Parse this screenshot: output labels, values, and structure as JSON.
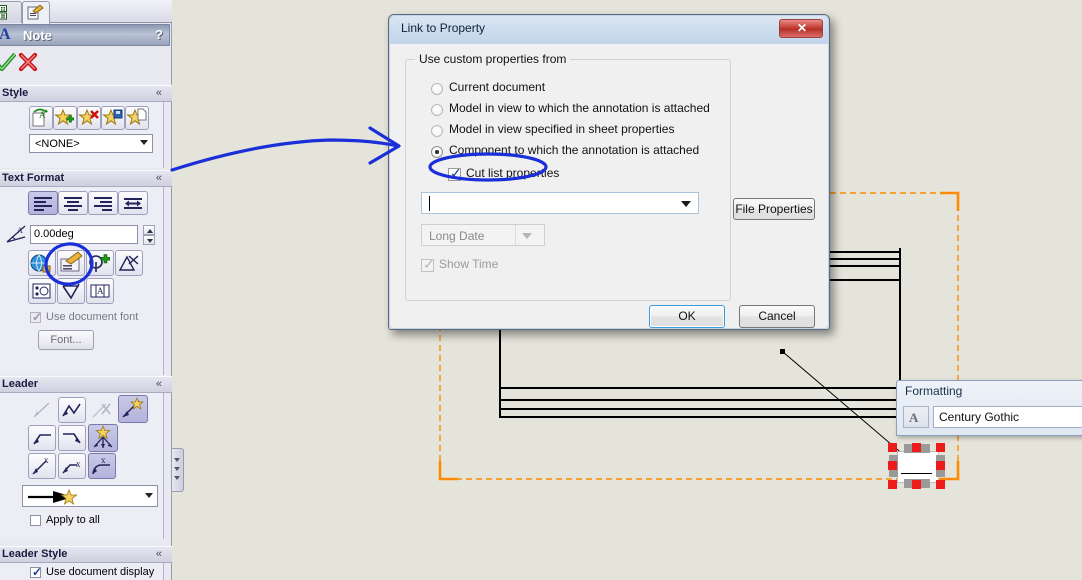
{
  "app": {
    "canvas_bg": "#E4E4DA",
    "accent_blue": "#1a3fd0",
    "orange": "#FF8C00",
    "handle_red": "#EE1B1B"
  },
  "property_manager": {
    "tabs": [
      {
        "name": "feature-manager-tab",
        "icon": "tree-icon"
      },
      {
        "name": "property-manager-tab",
        "icon": "note-pencil-icon"
      }
    ],
    "title": "Note",
    "help_glyph": "?",
    "actions": {
      "ok": "ok-check-icon",
      "cancel": "cancel-x-icon"
    },
    "sections": [
      {
        "id": "style",
        "title": "Style",
        "collapse_glyph": "«",
        "buttons": [
          "apply-style-icon",
          "add-style-icon",
          "delete-style-icon",
          "save-style-icon",
          "load-style-icon"
        ],
        "style_combo_value": "<NONE>"
      },
      {
        "id": "text-format",
        "title": "Text Format",
        "collapse_glyph": "«",
        "align_buttons": [
          "align-left-icon",
          "align-center-icon",
          "align-right-icon",
          "align-justify-icon"
        ],
        "angle_icon": "angle-dimension-icon",
        "angle_value": "0.00deg",
        "row2_buttons": [
          "insert-hyperlink-icon",
          "link-to-property-icon",
          "add-symbol-icon",
          "lock-note-icon"
        ],
        "row3_buttons": [
          "insert-shape-icon",
          "surface-finish-icon",
          "insert-geometric-tolerance-icon"
        ],
        "use_document_font": {
          "label": "Use document font",
          "checked": true,
          "enabled": false
        },
        "font_button": "Font..."
      },
      {
        "id": "leader",
        "title": "Leader",
        "collapse_glyph": "«",
        "leader_row1": [
          "leader-plain-icon",
          "leader-bent-icon",
          "leader-no-icon",
          "leader-auto-icon"
        ],
        "leader_row2": [
          "leader-left-icon",
          "leader-right-icon",
          "leader-multi-jog-icon"
        ],
        "leader_row3": [
          "leader-x-left-icon",
          "leader-x-right-icon",
          "leader-x-underline-icon"
        ],
        "arrow_style_value": "filled-arrow-auto",
        "apply_to_all": {
          "label": "Apply to all",
          "checked": false
        }
      },
      {
        "id": "leader-style",
        "title": "Leader Style",
        "collapse_glyph": "«",
        "use_document_display": {
          "label": "Use document display",
          "checked": true
        }
      }
    ]
  },
  "dialog": {
    "title": "Link to Property",
    "close_glyph": "✕",
    "group": {
      "caption": "Use custom properties from",
      "radios": [
        {
          "label": "Current document",
          "selected": false
        },
        {
          "label": "Model in view to which the annotation is attached",
          "selected": false
        },
        {
          "label": "Model in view specified in sheet properties",
          "selected": false
        },
        {
          "label": "Component to which the annotation is attached",
          "selected": true
        }
      ],
      "cut_list": {
        "label": "Cut list properties",
        "checked": true,
        "enabled": true
      },
      "property_combo": {
        "value": "",
        "placeholder": ""
      },
      "date_format_combo": {
        "value": "Long Date",
        "enabled": false
      },
      "show_time": {
        "label": "Show Time",
        "checked": true,
        "enabled": false
      }
    },
    "file_properties_button": "File Properties",
    "ok_button": "OK",
    "cancel_button": "Cancel"
  },
  "formatting_toolbar": {
    "title": "Formatting",
    "font_icon": "font-style-icon",
    "font_name": "Century Gothic"
  },
  "drawing": {
    "selection_handles_count": 8,
    "annotation_ink": "blue-ink-arrow-and-ellipse"
  }
}
